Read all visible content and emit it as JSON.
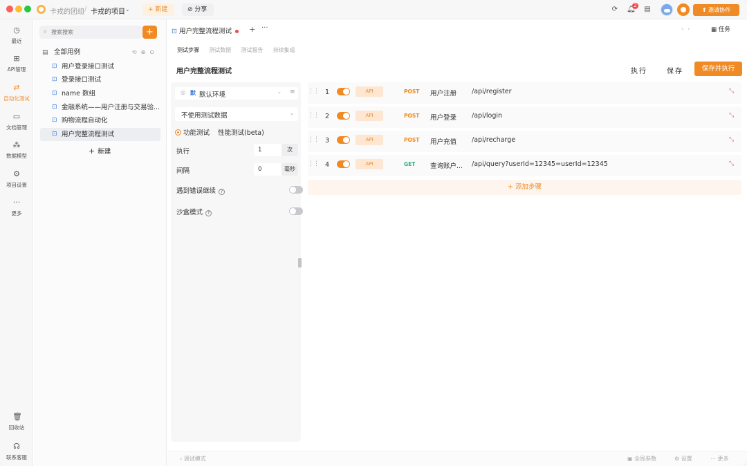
{
  "titlebar": {
    "team_name": "卡戎的团组",
    "separator": "/",
    "project_name": "卡戎的项目",
    "new_label": "+ 新建",
    "share_label": "分享",
    "notification_count": "2",
    "invite_label": "邀请协作"
  },
  "leftnav": {
    "items": [
      {
        "label": "最近",
        "icon": "clock-icon"
      },
      {
        "label": "API管理",
        "icon": "api-icon"
      },
      {
        "label": "自动化测试",
        "icon": "automation-icon"
      },
      {
        "label": "文档管理",
        "icon": "document-icon"
      },
      {
        "label": "数据模型",
        "icon": "model-icon"
      },
      {
        "label": "项目设置",
        "icon": "settings-icon"
      },
      {
        "label": "更多",
        "icon": "more-icon"
      }
    ],
    "trash_label": "回收站",
    "support_label": "联系客服"
  },
  "sidebar": {
    "search_placeholder": "搜索搜索",
    "root_label": "全部用例",
    "items": [
      {
        "label": "用户登录接口测试"
      },
      {
        "label": "登录接口测试"
      },
      {
        "label": "name 数组"
      },
      {
        "label": "金融系统——用户注册与交易验..."
      },
      {
        "label": "购物流程自动化"
      },
      {
        "label": "用户完整流程测试"
      }
    ],
    "new_label": "新建"
  },
  "main": {
    "doc_tab_title": "用户完整流程测试",
    "task_label": "任务",
    "subtabs": [
      "测试步骤",
      "测试数据",
      "测试报告",
      "持续集成"
    ],
    "case_title": "用户完整流程测试",
    "run_label": "执行",
    "save_label": "保存",
    "save_run_label": "保存并执行"
  },
  "config": {
    "env_tag": "默",
    "env_value": "默认环境",
    "data_value": "不使用测试数据",
    "mode_options": [
      "功能测试",
      "性能测试(beta)"
    ],
    "mode_selected": "功能测试",
    "run_count_label": "执行",
    "run_count_value": "1",
    "run_count_unit": "次",
    "interval_label": "间隔",
    "interval_value": "0",
    "interval_unit": "毫秒",
    "continue_on_error_label": "遇到错误继续",
    "continue_on_error": false,
    "sandbox_label": "沙盒模式",
    "sandbox": false
  },
  "steps": [
    {
      "num": "1",
      "enabled": true,
      "tag": "API",
      "method": "POST",
      "name": "用户注册",
      "path": "/api/register"
    },
    {
      "num": "2",
      "enabled": true,
      "tag": "API",
      "method": "POST",
      "name": "用户登录",
      "path": "/api/login"
    },
    {
      "num": "3",
      "enabled": true,
      "tag": "API",
      "method": "POST",
      "name": "用户充值",
      "path": "/api/recharge"
    },
    {
      "num": "4",
      "enabled": true,
      "tag": "API",
      "method": "GET",
      "name": "查询账户...",
      "path": "/api/query?userId=12345=userId=12345"
    }
  ],
  "add_step_label": "+ 添加步骤",
  "statusbar": {
    "left_label": "调试模式",
    "global_params": "全局参数",
    "settings": "设置",
    "more": "更多"
  }
}
